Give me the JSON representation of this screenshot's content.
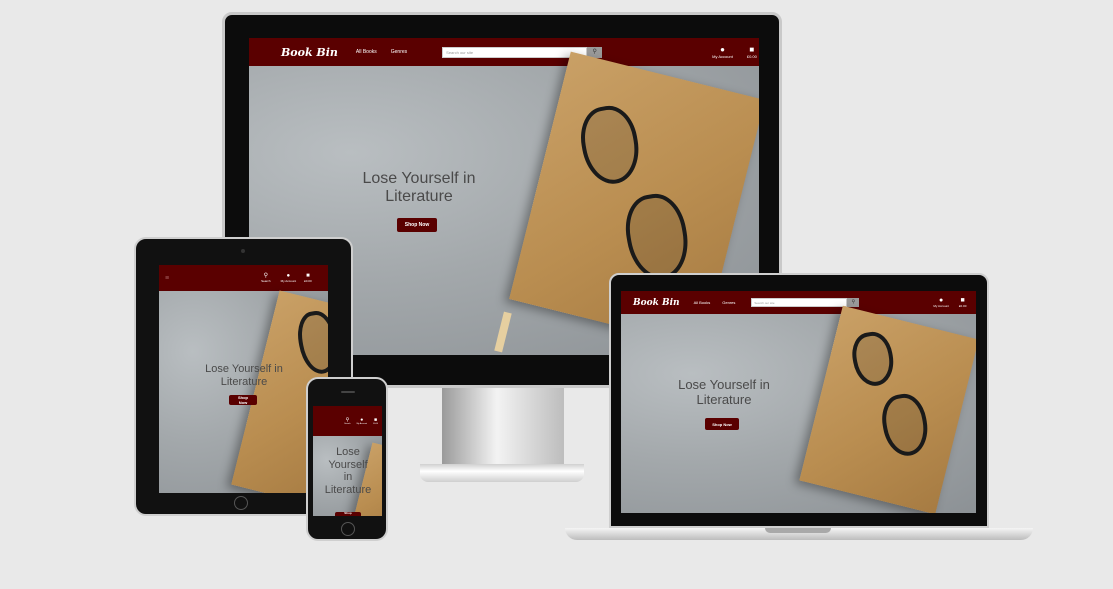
{
  "brand": "Book Bin",
  "nav": {
    "all_books": "All Books",
    "genres": "Genres",
    "search_placeholder": "Search our site",
    "my_account": "My Account",
    "cart_total": "£0.00",
    "search_label": "Search"
  },
  "hero": {
    "title_line1": "Lose Yourself in",
    "title_line2": "Literature",
    "cta": "Shop Now",
    "phone_title_1": "Lose",
    "phone_title_2": "Yourself",
    "phone_title_3": "in",
    "phone_title_4": "Literature"
  },
  "colors": {
    "nav": "#5a0000",
    "background": "#e9e9e9"
  },
  "icons": {
    "search": "search-icon",
    "account": "user-icon",
    "cart": "shopping-bag-icon",
    "menu": "hamburger-menu-icon"
  }
}
